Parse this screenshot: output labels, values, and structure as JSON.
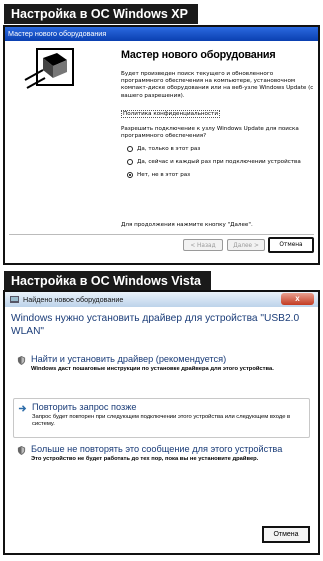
{
  "xp_section": {
    "header": "Настройка в ОС Windows XP",
    "window_title": "Мастер нового оборудования",
    "heading": "Мастер нового оборудования",
    "paragraph": "Будет произведен поиск текущего и обновленного программного обеспечения на компьютере, установочном компакт-диске оборудования или на веб-узле Windows Update (с вашего разрешения).",
    "privacy_link": "Политика конфиденциальности",
    "question": "Разрешить подключение к узлу Windows Update для поиска программного обеспечения?",
    "options": [
      {
        "label": "Да, только в этот раз"
      },
      {
        "label": "Да, сейчас и каждый раз при подключении устройства"
      },
      {
        "label": "Нет, не в этот раз"
      }
    ],
    "continue_text": "Для продолжения нажмите кнопку \"Далее\".",
    "back_button": "< Назад",
    "next_button": "Далее >",
    "cancel_button": "Отмена"
  },
  "vista_section": {
    "header": "Настройка в ОС Windows Vista",
    "window_title": "Найдено новое оборудование",
    "close_symbol": "x",
    "heading": "Windows нужно установить драйвер для устройства \"USB2.0 WLAN\"",
    "options": [
      {
        "title": "Найти и установить драйвер (рекомендуется)",
        "description": "Windows даст пошаговые инструкции по установке драйвера для этого устройства."
      },
      {
        "title": "Повторить запрос позже",
        "description": "Запрос будет повторен при следующем подключении этого устройства или следующем входе в систему."
      },
      {
        "title": "Больше не повторять это сообщение для этого устройства",
        "description": "Это устройство не будет работать до тех пор, пока вы не установите драйвер."
      }
    ],
    "cancel_button": "Отмена"
  },
  "colors": {
    "header_bg": "#1a1a1a",
    "xp_titlebar": "#0a3fb0",
    "vista_text": "#1a3c78"
  }
}
